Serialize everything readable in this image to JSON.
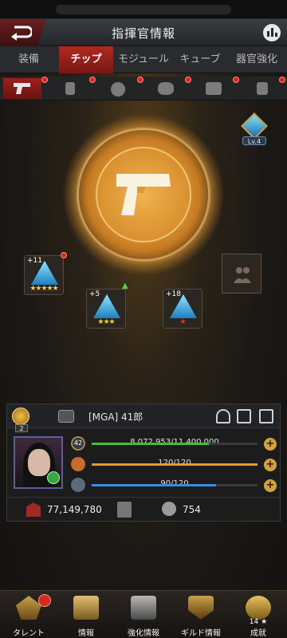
{
  "header": {
    "title": "指揮官情報"
  },
  "tabs": [
    {
      "label": "装備",
      "active": false
    },
    {
      "label": "チップ",
      "active": true
    },
    {
      "label": "モジュール",
      "active": false
    },
    {
      "label": "キューブ",
      "active": false
    },
    {
      "label": "器官強化",
      "active": false
    }
  ],
  "categories": [
    {
      "icon": "pistol-icon",
      "active": true
    },
    {
      "icon": "card-icon",
      "active": false
    },
    {
      "icon": "grenade-icon",
      "active": false
    },
    {
      "icon": "mask-icon",
      "active": false
    },
    {
      "icon": "vest-icon",
      "active": false
    },
    {
      "icon": "boot-icon",
      "active": false
    }
  ],
  "rank_badge": {
    "label": "Lv.4"
  },
  "chips": [
    {
      "level": "+11",
      "stars": "★★★★★",
      "star_color": "gold"
    },
    {
      "level": "+5",
      "stars": "★★★",
      "star_color": "gold"
    },
    {
      "level": "+18",
      "stars": "★",
      "star_color": "red"
    }
  ],
  "player": {
    "rank": "2",
    "name": "[MGA]  41郎",
    "level": "42",
    "exp": {
      "text": "8,072,953/11,400,000",
      "fraction": 0.708
    },
    "stamina": {
      "text": "120/120",
      "fraction": 1.0
    },
    "energy": {
      "text": "90/120",
      "fraction": 0.75
    },
    "power": "77,149,780",
    "kills": "754"
  },
  "colors": {
    "exp": "#3fbf3a",
    "stamina": "#e39a2e",
    "energy": "#2f8fe0",
    "accent": "#b02a22"
  },
  "nav": [
    {
      "label": "タレント",
      "icon": "talent-icon"
    },
    {
      "label": "情報",
      "icon": "info-icon"
    },
    {
      "label": "強化情報",
      "icon": "upgrade-icon"
    },
    {
      "label": "ギルド情報",
      "icon": "guild-icon"
    },
    {
      "label": "成就",
      "icon": "achievement-icon",
      "count": "14 ★"
    }
  ]
}
